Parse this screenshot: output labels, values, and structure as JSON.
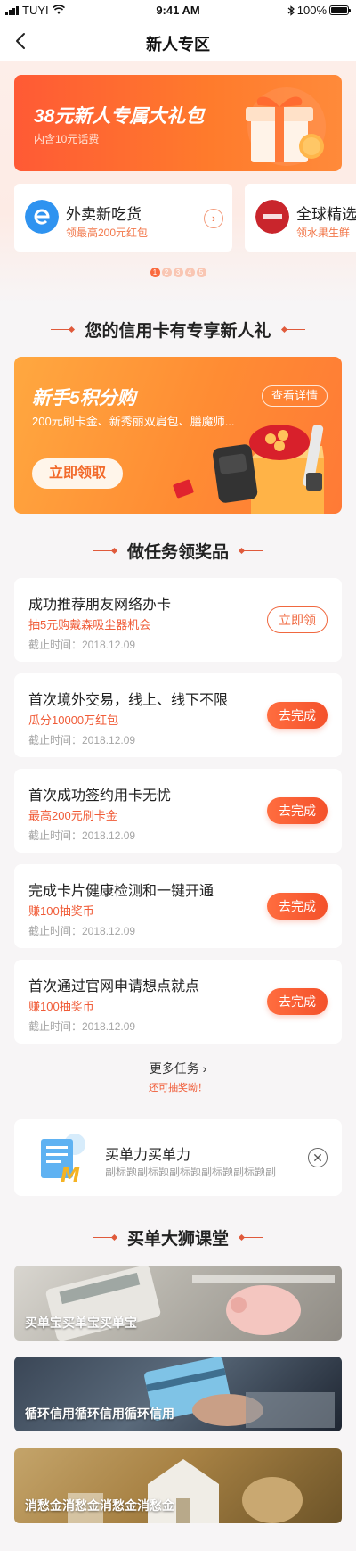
{
  "status_bar": {
    "carrier": "TUYI",
    "time": "9:41 AM",
    "battery": "100%"
  },
  "nav": {
    "title": "新人专区"
  },
  "hero": {
    "title": "38元新人专属大礼包",
    "subtitle": "内含10元话费"
  },
  "mini_cards": [
    {
      "title": "外卖新吃货",
      "subtitle": "领最高200元红包"
    },
    {
      "title": "全球精选",
      "subtitle": "领水果生鲜"
    }
  ],
  "carousel_dots": [
    "1",
    "2",
    "3",
    "4",
    "5"
  ],
  "section_credit": {
    "title": "您的信用卡有专享新人礼"
  },
  "promo": {
    "title": "新手5积分购",
    "subtitle": "200元刷卡金、新秀丽双肩包、膳魔师...",
    "detail_label": "查看详情",
    "cta_label": "立即领取"
  },
  "section_tasks": {
    "title": "做任务领奖品"
  },
  "tasks": [
    {
      "title": "成功推荐朋友网络办卡",
      "reward": "抽5元购戴森吸尘器机会",
      "date": "截止时间：2018.12.09",
      "button": "立即领",
      "style": "outline"
    },
    {
      "title": "首次境外交易，线上、线下不限",
      "reward": "瓜分10000万红包",
      "date": "截止时间：2018.12.09",
      "button": "去完成",
      "style": "solid"
    },
    {
      "title": "首次成功签约用卡无忧",
      "reward": "最高200元刷卡金",
      "date": "截止时间：2018.12.09",
      "button": "去完成",
      "style": "solid"
    },
    {
      "title": "完成卡片健康检测和一键开通",
      "reward": "赚100抽奖币",
      "date": "截止时间：2018.12.09",
      "button": "去完成",
      "style": "solid"
    },
    {
      "title": "首次通过官网申请想点就点",
      "reward": "赚100抽奖币",
      "date": "截止时间：2018.12.09",
      "button": "去完成",
      "style": "solid"
    }
  ],
  "more_tasks": {
    "label": "更多任务 ›",
    "sub": "还可抽奖呦！"
  },
  "promo_strip": {
    "title": "买单力买单力",
    "subtitle": "副标题副标题副标题副标题副标题副"
  },
  "section_course": {
    "title": "买单大狮课堂"
  },
  "courses": [
    {
      "label": "买单宝买单宝买单宝"
    },
    {
      "label": "循环信用循环信用循环信用"
    },
    {
      "label": "消愁金消愁金消愁金消愁金"
    }
  ],
  "colors": {
    "accent": "#f0683f",
    "hero_start": "#ff5a35",
    "promo_start": "#ffa840"
  }
}
